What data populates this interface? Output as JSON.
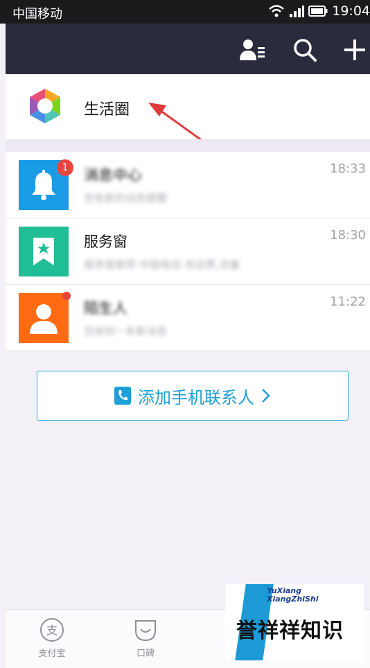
{
  "status": {
    "carrier": "中国移动",
    "time": "19:04"
  },
  "life_circle": {
    "label": "生活圈"
  },
  "messages": [
    {
      "title": "消息中心",
      "time": "18:33",
      "preview": "您有新的动态提醒",
      "badge": "1"
    },
    {
      "title": "服务窗",
      "time": "18:30",
      "preview": "服务窗推荐:中国电信-充话费,流量"
    },
    {
      "title": "陌生人",
      "time": "11:22",
      "preview": "您收到一条新消息"
    }
  ],
  "add_contact": {
    "label": "添加手机联系人"
  },
  "tabs": [
    {
      "label": "支付宝"
    },
    {
      "label": "口碑"
    }
  ],
  "watermark": {
    "line1": "YuXiang",
    "line2": "XiangZhiShi",
    "text": "誉祥祥知识"
  },
  "colors": {
    "header_bg": "#2a2c3d",
    "accent": "#1d9fd7",
    "bell_bg": "#1a9be6",
    "service_bg": "#1fbe95",
    "stranger_bg": "#ff6a13",
    "badge": "#e8453c"
  },
  "icons": [
    "signal-icon",
    "wifi-icon",
    "battery-icon",
    "contacts-icon",
    "search-icon",
    "plus-icon",
    "bell-icon",
    "star-bookmark-icon",
    "person-icon",
    "phone-icon",
    "chevron-right-icon",
    "alipay-icon",
    "koubei-icon"
  ]
}
